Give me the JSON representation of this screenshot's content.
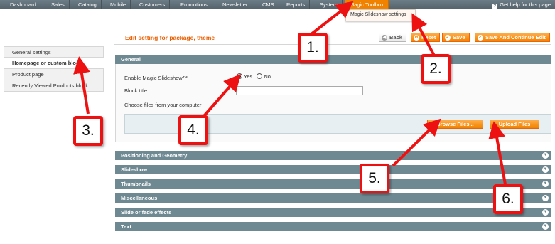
{
  "topnav": {
    "items": [
      "Dashboard",
      "Sales",
      "Catalog",
      "Mobile",
      "Customers",
      "Promotions",
      "Newsletter",
      "CMS",
      "Reports",
      "System",
      "Magic Toolbox"
    ],
    "help": "Get help for this page"
  },
  "dropdown": {
    "item": "Magic Slideshow settings"
  },
  "sidebar": {
    "items": [
      "General settings",
      "Homepage or custom block",
      "Product page",
      "Recently Viewed Products block"
    ]
  },
  "page": {
    "title": "Edit setting for package, theme",
    "buttons": {
      "back": "Back",
      "reset": "Reset",
      "save": "Save",
      "save_continue": "Save And Continue Edit"
    }
  },
  "general": {
    "title": "General",
    "enable_label": "Enable Magic Slideshow™",
    "yes": "Yes",
    "no": "No",
    "block_title_label": "Block title",
    "block_title_value": "",
    "choose_files_label": "Choose files from your computer",
    "browse_button": "Browse Files...",
    "upload_button": "Upload Files"
  },
  "sections": [
    "Positioning and Geometry",
    "Slideshow",
    "Thumbnails",
    "Miscellaneous",
    "Slide or fade effects",
    "Text"
  ],
  "callouts": [
    "1.",
    "2.",
    "3.",
    "4.",
    "5.",
    "6."
  ],
  "colors": {
    "accent": "#f18200",
    "nav": "#56646d",
    "section": "#6f8992",
    "title": "#eb5e00",
    "callout": "#ee1111"
  }
}
